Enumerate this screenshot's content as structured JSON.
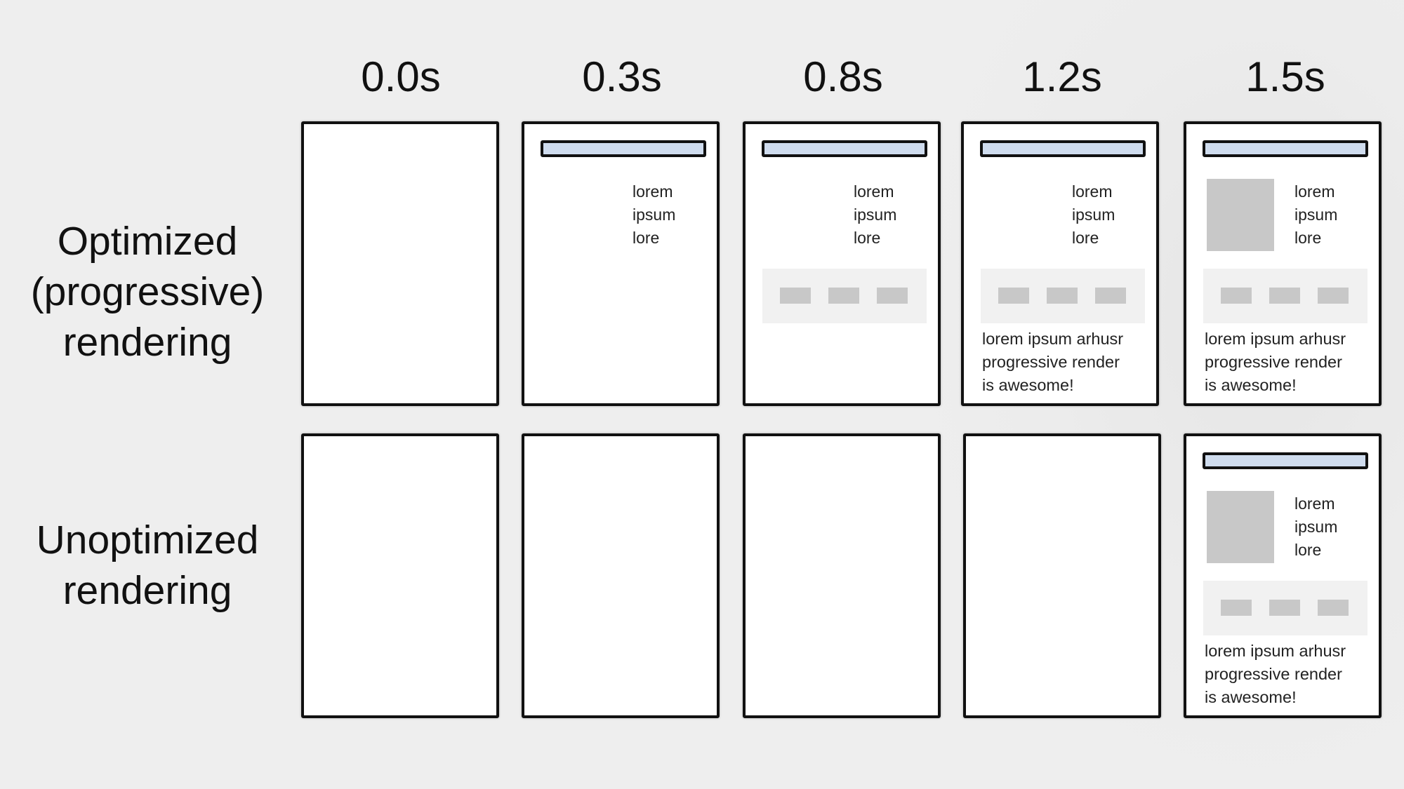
{
  "columns": [
    {
      "time": "0.0s"
    },
    {
      "time": "0.3s"
    },
    {
      "time": "0.8s"
    },
    {
      "time": "1.2s"
    },
    {
      "time": "1.5s"
    }
  ],
  "rows": [
    {
      "label_lines": [
        "Optimized",
        "(progressive)",
        "rendering"
      ]
    },
    {
      "label_lines": [
        "Unoptimized",
        "rendering"
      ]
    }
  ],
  "frame_content": {
    "side_text": [
      "lorem",
      "ipsum",
      "lore"
    ],
    "body_text": [
      "lorem ipsum arhusr",
      "progressive render",
      "is awesome!"
    ]
  },
  "colors": {
    "header_bar_fill": "#cfdcee",
    "placeholder_gray": "#c8c8c8",
    "nav_box_fill": "#f1f1f1",
    "frame_border": "#111111"
  }
}
